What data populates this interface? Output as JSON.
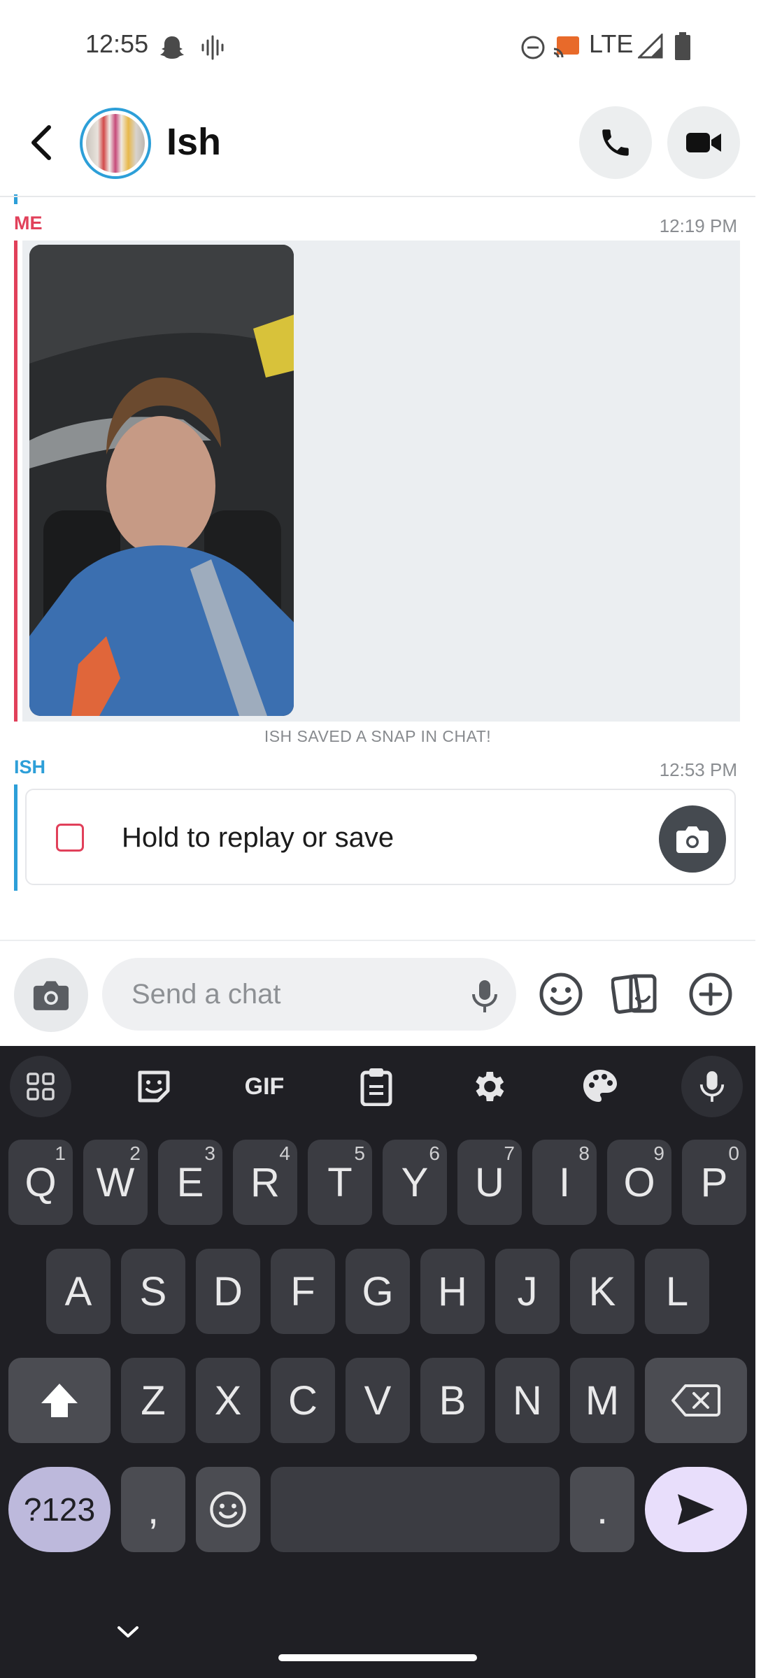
{
  "status_bar": {
    "time": "12:55",
    "network": "LTE"
  },
  "header": {
    "contact_name": "Ish"
  },
  "messages": [
    {
      "sender": "ME",
      "time": "12:19 PM",
      "type": "snap-image"
    },
    {
      "system_note": "ISH SAVED A SNAP IN CHAT!"
    },
    {
      "sender": "ISH",
      "time": "12:53 PM",
      "type": "snap",
      "label": "Hold to replay or save"
    }
  ],
  "composer": {
    "placeholder": "Send a chat"
  },
  "keyboard": {
    "toolbar": {
      "gif_label": "GIF"
    },
    "row1": [
      "Q",
      "W",
      "E",
      "R",
      "T",
      "Y",
      "U",
      "I",
      "O",
      "P"
    ],
    "row1_hints": [
      "1",
      "2",
      "3",
      "4",
      "5",
      "6",
      "7",
      "8",
      "9",
      "0"
    ],
    "row2": [
      "A",
      "S",
      "D",
      "F",
      "G",
      "H",
      "J",
      "K",
      "L"
    ],
    "row3": [
      "Z",
      "X",
      "C",
      "V",
      "B",
      "N",
      "M"
    ],
    "symbols_label": "?123",
    "comma": ",",
    "period": "."
  },
  "colors": {
    "me": "#e1405a",
    "ish": "#2d9fd8",
    "keyboard_bg": "#1f1f24"
  }
}
